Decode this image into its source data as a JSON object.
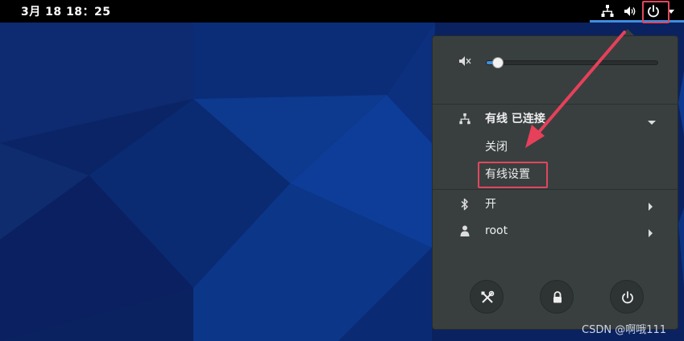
{
  "topbar": {
    "clock": "3月 18  18：25"
  },
  "menu": {
    "volume": {
      "level": 0.06
    },
    "network": {
      "title": "有线 已连接",
      "items": [
        {
          "label": "关闭"
        },
        {
          "label": "有线设置"
        }
      ]
    },
    "bluetooth": {
      "label": "开"
    },
    "user": {
      "label": "root"
    },
    "buttons": [
      "settings-icon",
      "lock-icon",
      "power-icon"
    ]
  },
  "watermark": "CSDN @啊哦111",
  "colors": {
    "accent": "#3f8de0",
    "highlight": "#e0475f",
    "menu_bg": "#393f3f",
    "topbar_bg": "#000000"
  }
}
